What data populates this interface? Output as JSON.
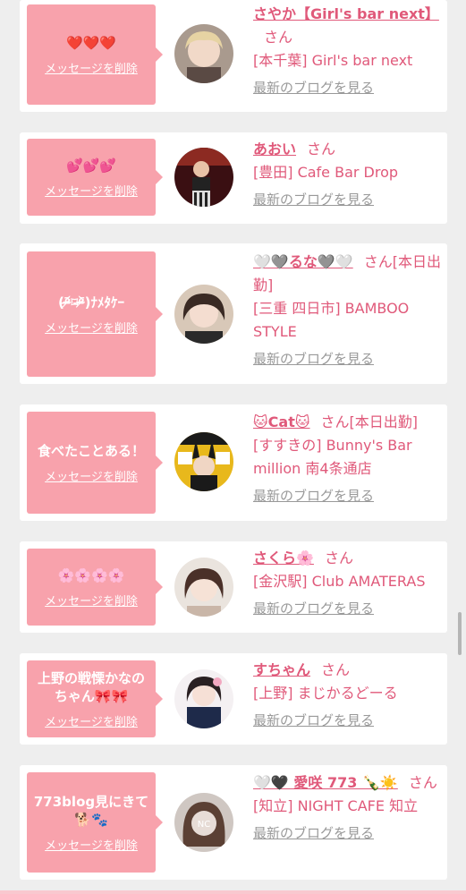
{
  "delete_label": "メッセージを削除",
  "blog_label": "最新のブログを見る",
  "san_label": "さん",
  "colors": {
    "bubble": "#f8a2ac",
    "accent": "#e0597a",
    "link_gray": "#999999",
    "background": "#eeeeee"
  },
  "cards": [
    {
      "message": "❤️❤️❤️",
      "name": "さやか【Girl's bar next】",
      "san_suffix": "さん",
      "shop": "[本千葉] Girl's bar next",
      "avatar_icon": "avatar-photo-icon"
    },
    {
      "message": "💕💕💕",
      "name": "あおい",
      "san_suffix": "さん",
      "shop": "[豊田] Cafe Bar Drop",
      "avatar_icon": "avatar-photo-icon"
    },
    {
      "message": "(ᵒ̴̶̷᷄⌑ᵒ̴̶̷᷅)ﾅﾒﾀｹｰ",
      "name": "🤍🩶るな🩶🤍",
      "san_suffix": "さん[本日出勤]",
      "shop": "[三重 四日市] BAMBOO STYLE",
      "avatar_icon": "avatar-photo-icon"
    },
    {
      "message": "食べたことある！",
      "name": "🐱Cat🐱",
      "san_suffix": "さん[本日出勤]",
      "shop": "[すすきの] Bunny's Bar million 南4条通店",
      "avatar_icon": "avatar-photo-icon"
    },
    {
      "message": "🌸🌸🌸🌸",
      "name": "さくら🌸",
      "san_suffix": "さん",
      "shop": "[金沢駅] Club AMATERAS",
      "avatar_icon": "avatar-photo-icon"
    },
    {
      "message": "上野の戦慄かなのちゃん🎀🎀",
      "name": "すちゃん",
      "san_suffix": "さん",
      "shop": "[上野] まじかるどーる",
      "avatar_icon": "avatar-photo-icon"
    },
    {
      "message": "773blog見にきて🐕🐾",
      "name": "🤍🖤 愛咲 773 🍾☀️",
      "san_suffix": "さん",
      "shop": "[知立] NIGHT CAFE 知立",
      "avatar_icon": "avatar-photo-icon"
    }
  ]
}
